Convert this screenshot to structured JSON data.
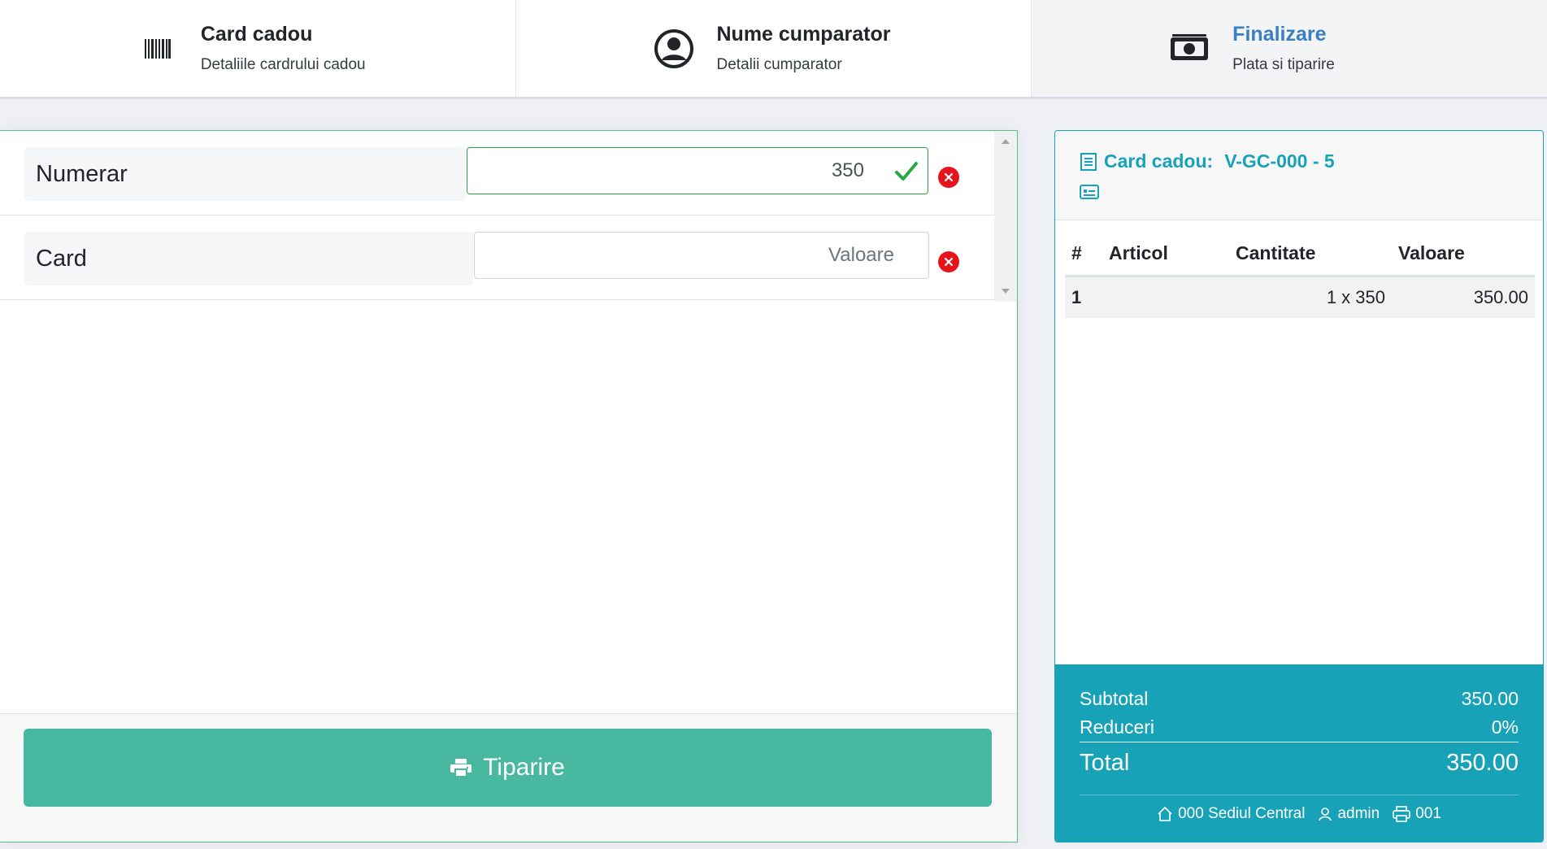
{
  "stepper": {
    "steps": [
      {
        "title": "Card cadou",
        "subtitle": "Detaliile cardrului cadou",
        "icon": "barcode-icon"
      },
      {
        "title": "Nume cumparator",
        "subtitle": "Detalii cumparator",
        "icon": "user-circle-icon"
      },
      {
        "title": "Finalizare",
        "subtitle": "Plata si tiparire",
        "icon": "money-icon",
        "active": true
      }
    ]
  },
  "payments": [
    {
      "label": "Numerar",
      "value": "350",
      "placeholder": "Valoare",
      "valid": true
    },
    {
      "label": "Card",
      "value": "",
      "placeholder": "Valoare",
      "valid": false
    }
  ],
  "print_button": {
    "label": "Tiparire",
    "icon": "printer-icon"
  },
  "receipt": {
    "title_prefix": "Card cadou:",
    "code": "V-GC-000 - 5",
    "table": {
      "headers": [
        "#",
        "Articol",
        "Cantitate",
        "Valoare"
      ],
      "rows": [
        {
          "num": "1",
          "article": "",
          "quantity": "1 x 350",
          "value": "350.00"
        }
      ]
    },
    "totals": {
      "subtotal_label": "Subtotal",
      "subtotal_value": "350.00",
      "discount_label": "Reduceri",
      "discount_value": "0%",
      "total_label": "Total",
      "total_value": "350.00"
    },
    "footer": {
      "location": "000 Sediul Central",
      "user": "admin",
      "register": "001"
    }
  },
  "colors": {
    "accent": "#17a2b8",
    "success": "#28a745",
    "danger": "#e8141c",
    "print_button": "#48b8a0",
    "active_step": "#3a7fc1"
  }
}
